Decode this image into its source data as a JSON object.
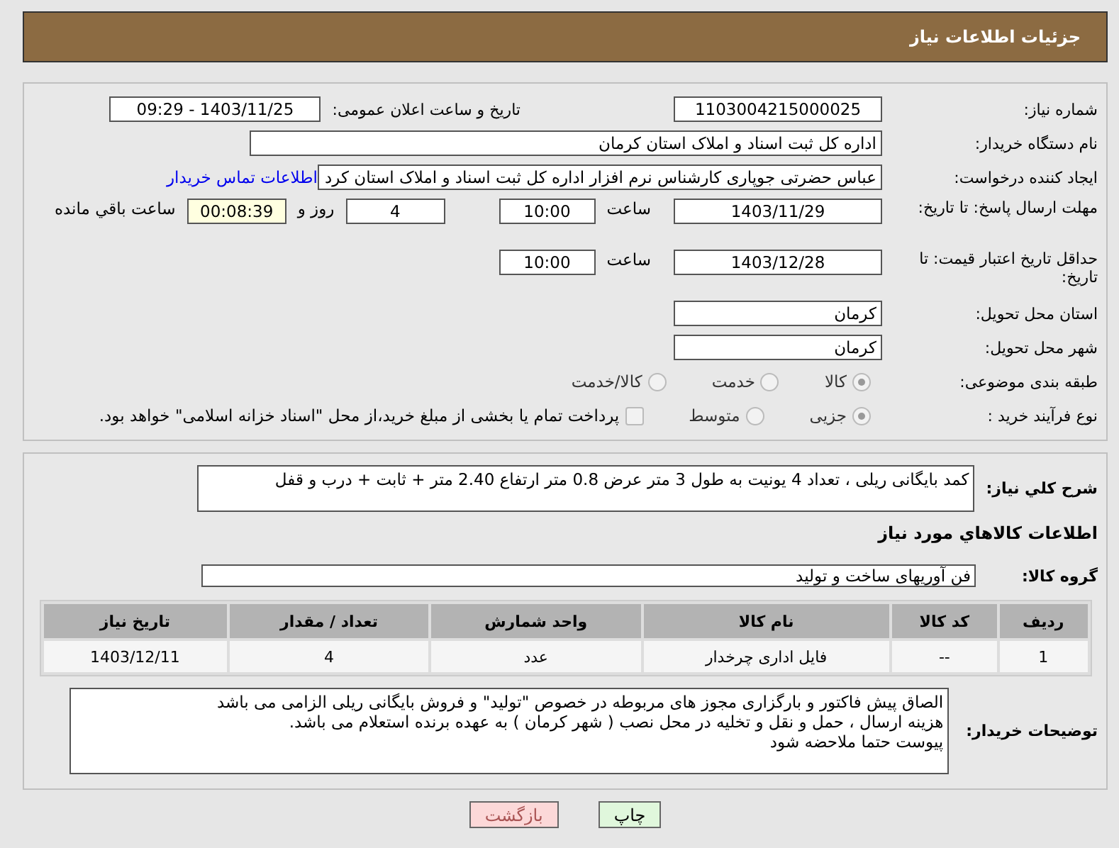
{
  "header": {
    "title": "جزئیات اطلاعات نیاز"
  },
  "need_number": {
    "label": "شماره نیاز:",
    "value": "1103004215000025"
  },
  "announce": {
    "label": "تاریخ و ساعت اعلان عمومی:",
    "value": "1403/11/25 - 09:29"
  },
  "buyer_org": {
    "label": "نام دستگاه خریدار:",
    "value": "اداره کل ثبت اسناد و املاک استان کرمان"
  },
  "requester": {
    "label": "ایجاد کننده درخواست:",
    "value": "عباس حضرتی جوپاری کارشناس نرم افزار اداره کل ثبت اسناد و املاک استان کرد",
    "link": "اطلاعات تماس خریدار"
  },
  "deadline": {
    "label": "مهلت ارسال پاسخ: تا تاریخ:",
    "date": "1403/11/29",
    "time_label": "ساعت",
    "time": "10:00",
    "days": "4",
    "days_label": "روز و",
    "remaining": "00:08:39",
    "remaining_label": "ساعت باقي مانده"
  },
  "validity": {
    "label": "حداقل تاریخ اعتبار قیمت: تا تاریخ:",
    "date": "1403/12/28",
    "time_label": "ساعت",
    "time": "10:00"
  },
  "province": {
    "label": "استان محل تحویل:",
    "value": "کرمان"
  },
  "city": {
    "label": "شهر محل تحویل:",
    "value": "کرمان"
  },
  "category": {
    "label": "طبقه بندی موضوعی:",
    "options": [
      {
        "label": "کالا",
        "selected": true
      },
      {
        "label": "خدمت",
        "selected": false
      },
      {
        "label": "کالا/خدمت",
        "selected": false
      }
    ]
  },
  "process": {
    "label": "نوع فرآیند خرید :",
    "options": [
      {
        "label": "جزیی",
        "selected": true
      },
      {
        "label": "متوسط",
        "selected": false
      }
    ],
    "payment": {
      "label": "پرداخت تمام یا بخشی از مبلغ خرید،از محل \"اسناد خزانه اسلامی\" خواهد بود.",
      "checked": false
    }
  },
  "summary": {
    "label": "شرح کلي نياز:",
    "value": "کمد بایگانی ریلی ، تعداد 4 یونیت به  طول 3 متر عرض 0.8 متر ارتفاع 2.40 متر + ثابت + درب و قفل"
  },
  "goods_heading": "اطلاعات کالاهاي مورد نياز",
  "goods_group": {
    "label": "گروه کالا:",
    "value": "فن آوریهای ساخت و تولید"
  },
  "table": {
    "columns": [
      "ردیف",
      "کد کالا",
      "نام کالا",
      "واحد شمارش",
      "تعداد / مقدار",
      "تاریخ نیاز"
    ],
    "rows": [
      [
        "1",
        "--",
        "فایل اداری چرخدار",
        "عدد",
        "4",
        "1403/12/11"
      ]
    ]
  },
  "buyer_notes": {
    "label": "توضیحات خریدار:",
    "lines": [
      "الصاق پیش فاکتور و بارگزاری مجوز های مربوطه در خصوص \"تولید\" و فروش بایگانی ریلی الزامی می باشد",
      "هزینه ارسال ، حمل و نقل و تخلیه در محل نصب ( شهر کرمان ) به عهده برنده استعلام می باشد.",
      "پیوست حتما ملاحضه شود"
    ]
  },
  "buttons": [
    {
      "label": "چاپ",
      "kind": "print"
    },
    {
      "label": "بازگشت",
      "kind": "back"
    }
  ]
}
